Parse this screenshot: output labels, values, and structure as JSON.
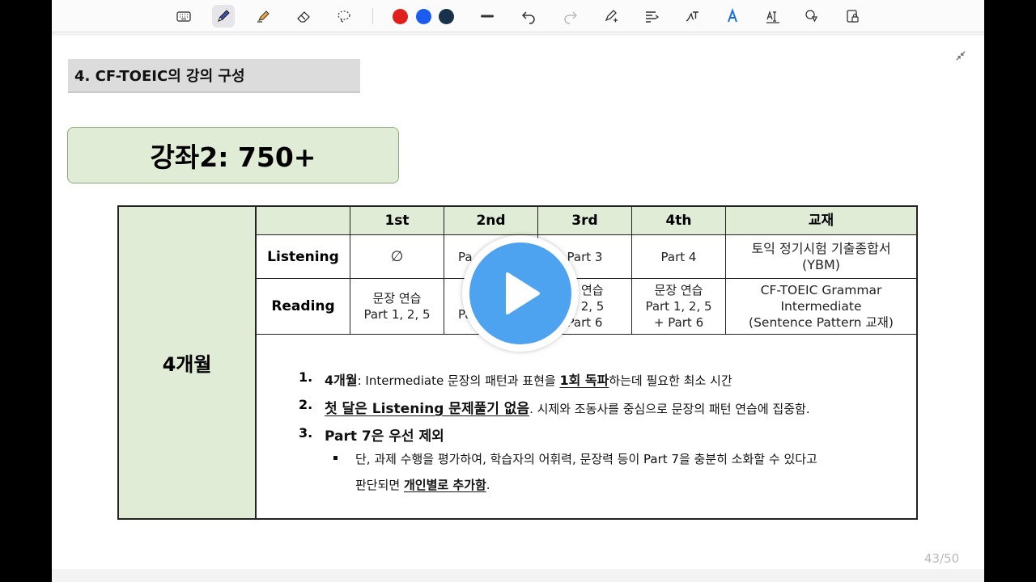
{
  "toolbar": {
    "items": [
      "keyboard-icon",
      "pen-icon",
      "highlighter-icon",
      "eraser-icon",
      "lasso-icon"
    ],
    "colors": [
      "#e0201f",
      "#1a5cf0",
      "#17324a"
    ],
    "undo_icon": "undo-icon",
    "redo_icon": "redo-icon"
  },
  "slide": {
    "section_title": "4. CF-TOEIC의 강의 구성",
    "course_title": "강좌2: 750+",
    "duration": "4개월",
    "table": {
      "headers": [
        "",
        "1st",
        "2nd",
        "3rd",
        "4th",
        "교재"
      ],
      "listening": {
        "label": "Listening",
        "cells": [
          "∅",
          "Pa",
          "Part 3",
          "Part 4"
        ],
        "book": "토익 정기시험 기출종합서\n(YBM)"
      },
      "reading": {
        "label": "Reading",
        "cells": [
          "문장 연습\nPart 1, 2, 5",
          "\nPa",
          "장 연습\n1, 2, 5\nPart 6",
          "문장 연습\nPart 1, 2, 5\n+ Part 6"
        ],
        "book": "CF-TOEIC Grammar\nIntermediate\n(Sentence Pattern 교재)"
      }
    },
    "notes": {
      "n1_num": "1.",
      "n1_bold": "4개월",
      "n1_a": ": Intermediate 문장의 패턴과 표현을 ",
      "n1_u": "1회 독파",
      "n1_b": "하는데 필요한 최소 시간",
      "n2_num": "2.",
      "n2_u": "첫 달은 Listening 문제풀기 없음",
      "n2_b": ". 시제와 조동사를 중심으로 문장의 패턴 연습에 집중함.",
      "n3_num": "3.",
      "n3_bold": "Part 7은 우선 제외",
      "bullet_a": "단, 과제 수행을 평가하여, 학습자의 어휘력, 문장력 등이 Part 7을 충분히 소화할 수 있다고",
      "bullet_b": "판단되면 ",
      "bullet_u": "개인별로 추가함",
      "bullet_end": "."
    }
  },
  "page_indicator": "43/50"
}
